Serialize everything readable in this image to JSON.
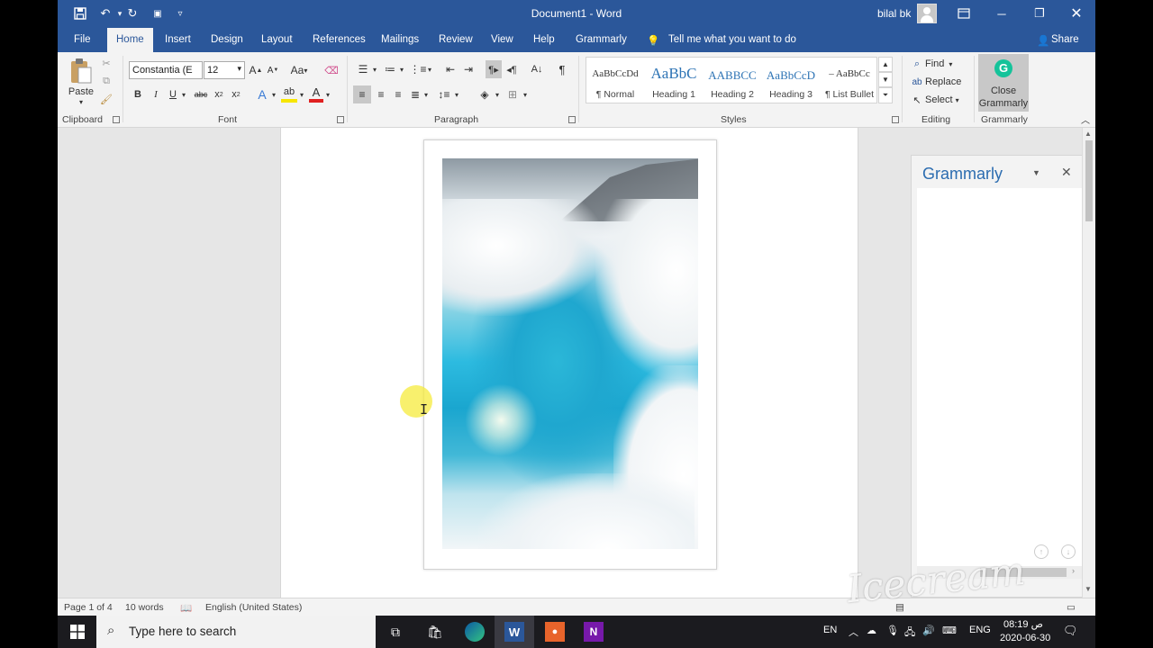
{
  "titlebar": {
    "title": "Document1  -  Word",
    "user": "bilal bk"
  },
  "tabs": [
    "File",
    "Home",
    "Insert",
    "Design",
    "Layout",
    "References",
    "Mailings",
    "Review",
    "View",
    "Help",
    "Grammarly"
  ],
  "tell_me": "Tell me what you want to do",
  "share": "Share",
  "ribbon": {
    "clipboard": {
      "paste": "Paste",
      "label": "Clipboard"
    },
    "font": {
      "name": "Constantia (E",
      "size": "12",
      "label": "Font",
      "case_btn": "Aa"
    },
    "paragraph": {
      "label": "Paragraph"
    },
    "styles": {
      "label": "Styles",
      "items": [
        {
          "sample": "AaBbCcDd",
          "name": "¶ Normal",
          "color": "#333333",
          "size": "11px"
        },
        {
          "sample": "AaBbC",
          "name": "Heading 1",
          "color": "#2e74b5",
          "size": "17px"
        },
        {
          "sample": "AABBCC",
          "name": "Heading 2",
          "color": "#2e74b5",
          "size": "13px"
        },
        {
          "sample": "AaBbCcD",
          "name": "Heading 3",
          "color": "#2e74b5",
          "size": "13px"
        },
        {
          "sample": "–  AaBbCc",
          "name": "¶ List Bullet",
          "color": "#333333",
          "size": "11px"
        }
      ]
    },
    "editing": {
      "find": "Find",
      "replace": "Replace",
      "select": "Select",
      "label": "Editing"
    },
    "grammarly": {
      "close": "Close",
      "close2": "Grammarly",
      "label": "Grammarly"
    }
  },
  "pane": {
    "title": "Grammarly"
  },
  "status": {
    "page": "Page 1 of 4",
    "words": "10 words",
    "language": "English (United States)"
  },
  "taskbar": {
    "search_placeholder": "Type here to search",
    "lang_left": "EN",
    "lang_right": "ENG",
    "time": "08:19 ص",
    "date": "2020-06-30"
  },
  "watermark": "Icecream"
}
